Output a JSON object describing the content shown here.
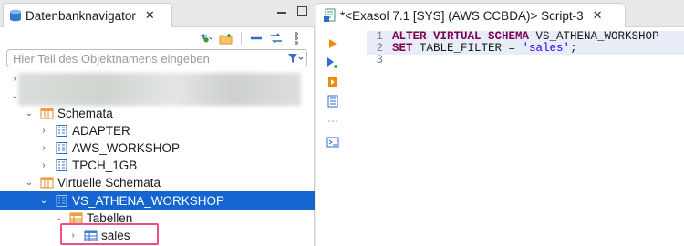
{
  "left_panel": {
    "tab_title": "Datenbanknavigator",
    "tab_close": "✕",
    "search_placeholder": "Hier Teil des Objektnamens eingeben",
    "tree": {
      "schemas_label": "Schemata",
      "schemas": [
        "ADAPTER",
        "AWS_WORKSHOP",
        "TPCH_1GB"
      ],
      "virtual_schemas_label": "Virtuelle Schemata",
      "virtual_schema": "VS_ATHENA_WORKSHOP",
      "tables_label": "Tabellen",
      "table": "sales"
    }
  },
  "right_panel": {
    "tab_title": "*<Exasol 7.1 [SYS] (AWS CCBDA)> Script-3",
    "tab_close": "✕",
    "line_numbers": [
      "1",
      "2",
      "3"
    ],
    "code": {
      "line1_kw1": "ALTER VIRTUAL SCHEMA",
      "line1_rest": " VS_ATHENA_WORKSHOP",
      "line2_kw": "SET",
      "line2_mid": " TABLE_FILTER = ",
      "line2_str": "'sales'",
      "line2_end": ";"
    }
  },
  "colors": {
    "selection": "#1565d0",
    "highlight_border": "#ef4f82",
    "keyword": "#7f0055",
    "string": "#2a00ff"
  }
}
